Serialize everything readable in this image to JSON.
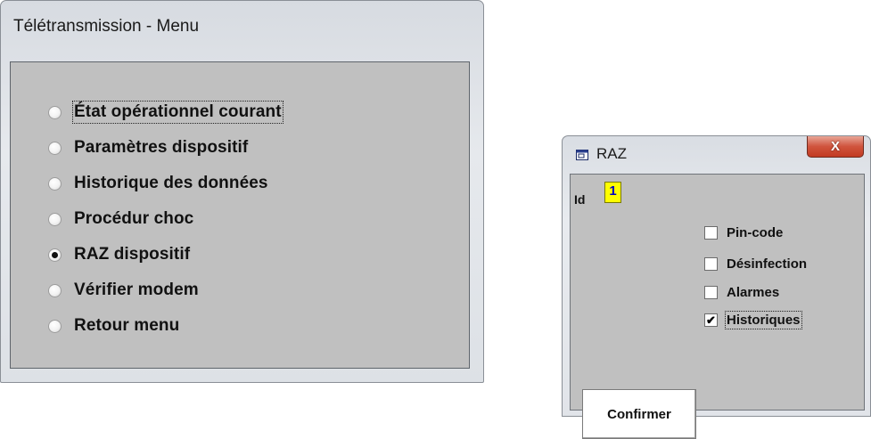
{
  "menu_window": {
    "title": "Télétransmission - Menu",
    "options": [
      {
        "label": "État opérationnel courant",
        "selected": false,
        "focused": true
      },
      {
        "label": "Paramètres dispositif",
        "selected": false,
        "focused": false
      },
      {
        "label": "Historique des données",
        "selected": false,
        "focused": false
      },
      {
        "label": "Procédur choc",
        "selected": false,
        "focused": false
      },
      {
        "label": "RAZ dispositif",
        "selected": true,
        "focused": false
      },
      {
        "label": "Vérifier modem",
        "selected": false,
        "focused": false
      },
      {
        "label": "Retour menu",
        "selected": false,
        "focused": false
      }
    ]
  },
  "raz_window": {
    "title": "RAZ",
    "close_label": "X",
    "id_label": "Id",
    "id_value": "1",
    "checkboxes": [
      {
        "label": "Pin-code",
        "checked": false,
        "focused": false
      },
      {
        "label": "Désinfection",
        "checked": false,
        "focused": false
      },
      {
        "label": "Alarmes",
        "checked": false,
        "focused": false
      },
      {
        "label": "Historiques",
        "checked": true,
        "focused": true
      }
    ],
    "confirm_label": "Confirmer",
    "check_glyph": "✔"
  }
}
